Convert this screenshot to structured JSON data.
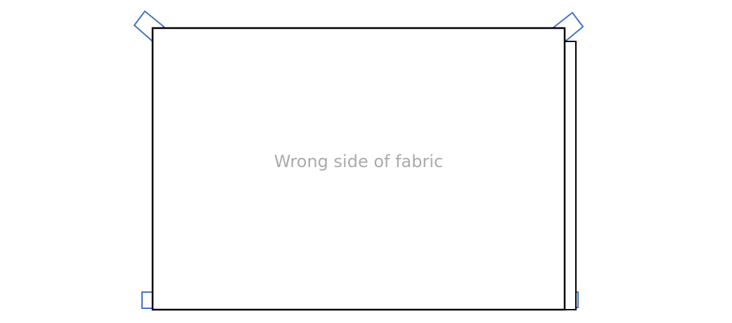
{
  "fabric": {
    "label": "Wrong side of fabric",
    "label_color": "#ababab",
    "outline_color": "#000000",
    "fill_color": "#ffffff"
  },
  "tape": {
    "color": "#4472c4"
  }
}
